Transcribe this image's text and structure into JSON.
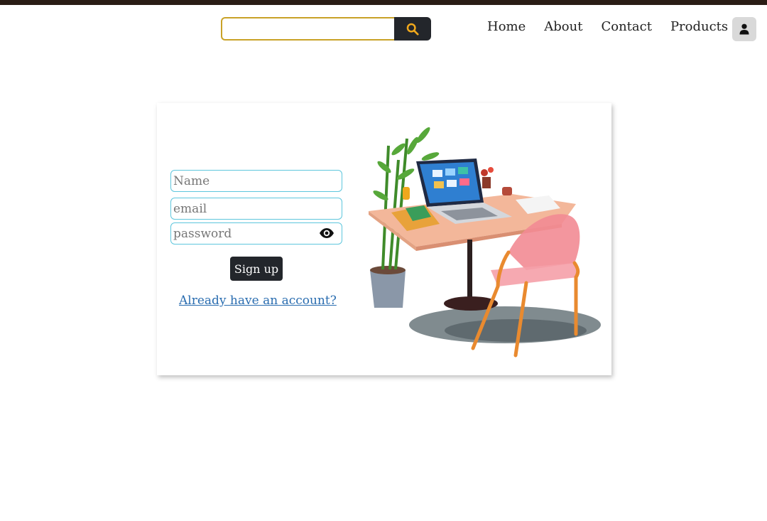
{
  "header": {
    "search": {
      "placeholder": "",
      "value": "",
      "button_icon": "search-icon"
    },
    "nav": [
      {
        "label": "Home"
      },
      {
        "label": "About"
      },
      {
        "label": "Contact"
      },
      {
        "label": "Products"
      }
    ],
    "account_icon": "user-icon"
  },
  "form": {
    "name_placeholder": "Name",
    "email_placeholder": "email",
    "password_placeholder": "password",
    "password_toggle_icon": "eye-icon",
    "submit_label": "Sign up",
    "login_link": "Already have an account?"
  },
  "illustration": {
    "subject": "desk-with-laptop-chair-plant"
  },
  "colors": {
    "top_bar": "#2a1d15",
    "search_border": "#c9a227",
    "search_icon": "#f0a81c",
    "dark_button": "#23262b",
    "input_border": "#5ec6dd",
    "link": "#2a6db0"
  }
}
